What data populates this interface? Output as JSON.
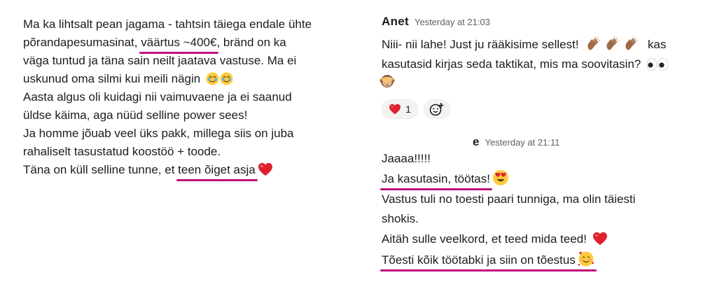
{
  "left_message": {
    "lines": [
      "Ma ka lihtsalt pean jagama - tahtsin täiega endale ühte",
      "põrandapesumasinat,",
      "väärtus ~400€",
      ", bränd on ka",
      "väga tuntud ja täna sain neilt jaatava vastuse. Ma ei",
      "uskunud oma silmi kui meili nägin",
      "Aasta algus oli kuidagi nii vaimuvaene ja ei saanud",
      "üldse käima, aga nüüd selline power sees!",
      "Ja homme jõuab veel üks pakk, millega siis on juba",
      "rahaliselt tasustatud koostöö + toode.",
      "Täna on küll selline tunne, et",
      "teen õiget asja"
    ]
  },
  "right_messages": [
    {
      "author": "Anet",
      "timestamp": "Yesterday at 21:03",
      "lines": [
        "Niii- nii lahe! Just ju rääkisime sellest!",
        "kas",
        "kasutasid kirjas seda taktikat, mis ma soovitasin?"
      ],
      "reaction_count": "1"
    },
    {
      "author": "e",
      "timestamp": "Yesterday at 21:11",
      "lines": [
        "Jaaaa!!!!!",
        "Ja kasutasin, töötas!",
        "Vastus tuli no toesti paari tunniga, ma olin täiesti",
        "shokis.",
        "Aitäh sulle veelkord, et teed mida teed!",
        "Tõesti kõik töötabki ja siin on tõestus"
      ]
    }
  ],
  "colors": {
    "underline": "#c0117a",
    "heart": "#e0202f",
    "text": "#1d1c1d",
    "timestamp": "#616061"
  },
  "icons": [
    "tear-smile-icon",
    "red-heart-icon",
    "clap-icon",
    "eyes-icon",
    "see-no-evil-monkey-icon",
    "heart-eyes-icon",
    "smile-hearts-icon",
    "add-reaction-icon"
  ]
}
